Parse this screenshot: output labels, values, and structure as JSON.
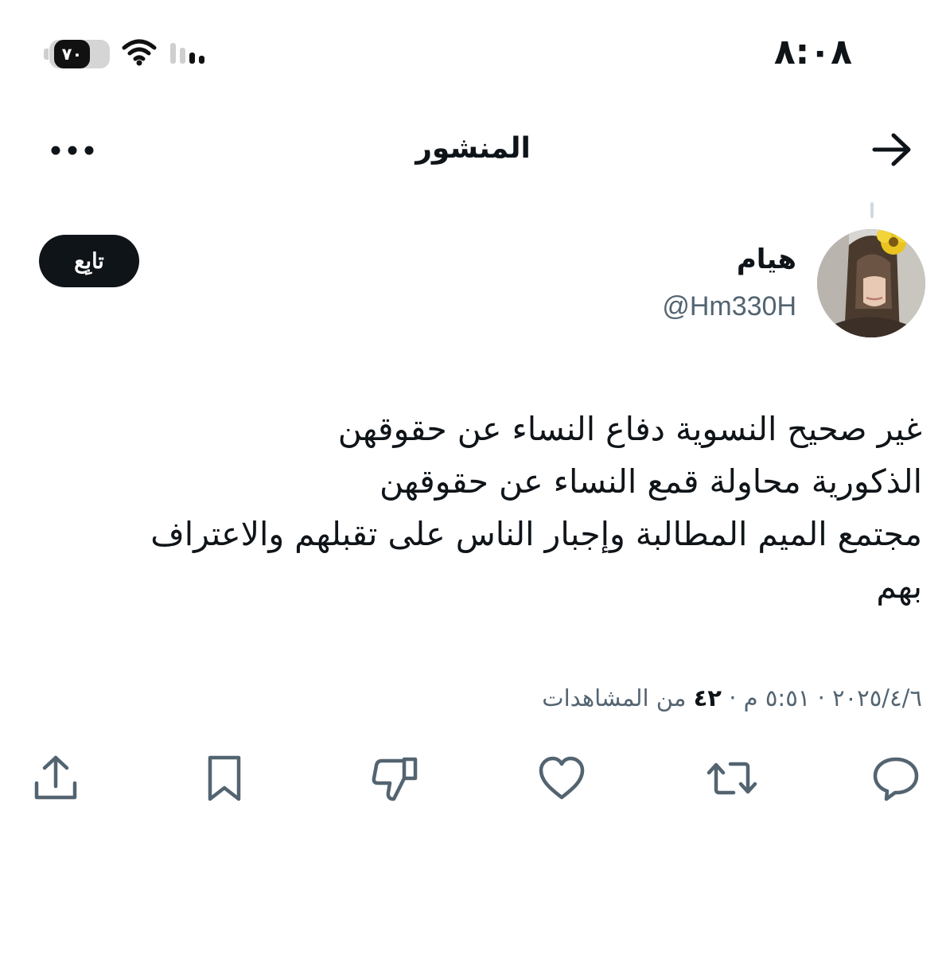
{
  "status_bar": {
    "time": "٨:٠٨",
    "battery_level": "٧٠",
    "battery_percent": 70
  },
  "nav": {
    "title": "المنشور",
    "back_icon": "arrow-right-icon",
    "more_icon": "more-horizontal-icon"
  },
  "author": {
    "display_name": "هيام",
    "handle": "@Hm330H",
    "follow_label": "تابِع"
  },
  "post": {
    "lines": [
      "غير صحيح النسوية دفاع النساء عن حقوقهن",
      "الذكورية محاولة قمع النساء عن حقوقهن",
      "مجتمع الميم المطالبة وإجبار الناس على تقبلهم والاعتراف",
      "بهم"
    ]
  },
  "meta": {
    "date": "٢٠٢٥/٤/٦",
    "separator": "·",
    "time": "٥:٥١ م",
    "views_count": "٤٢",
    "views_label": "من المشاهدات"
  },
  "actions": [
    {
      "name": "reply",
      "icon": "reply-icon"
    },
    {
      "name": "repost",
      "icon": "repost-icon"
    },
    {
      "name": "like",
      "icon": "heart-icon"
    },
    {
      "name": "dislike",
      "icon": "thumbs-down-icon"
    },
    {
      "name": "bookmark",
      "icon": "bookmark-icon"
    },
    {
      "name": "share",
      "icon": "share-icon"
    }
  ],
  "colors": {
    "text": "#0f1419",
    "secondary": "#536471",
    "follow_bg": "#0f1419",
    "background": "#ffffff"
  }
}
